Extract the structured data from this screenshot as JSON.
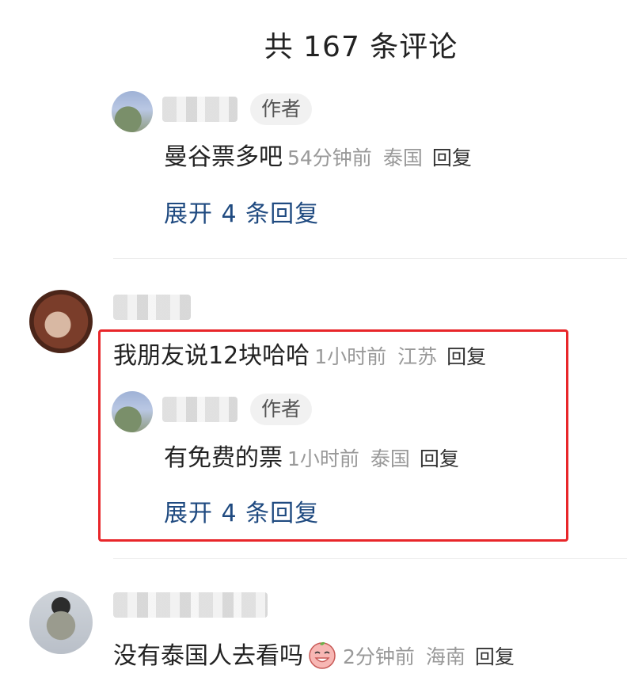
{
  "header": {
    "title": "共 167 条评论"
  },
  "comments": [
    {
      "is_reply": true,
      "author_badge": "作者",
      "text": "曼谷票多吧",
      "time": "54分钟前",
      "location": "泰国",
      "reply_label": "回复",
      "expand_label": "展开 4 条回复"
    },
    {
      "is_reply": false,
      "text": "我朋友说12块哈哈",
      "time": "1小时前",
      "location": "江苏",
      "reply_label": "回复",
      "child": {
        "author_badge": "作者",
        "text": "有免费的票",
        "time": "1小时前",
        "location": "泰国",
        "reply_label": "回复",
        "expand_label": "展开 4 条回复"
      }
    },
    {
      "is_reply": false,
      "text": "没有泰国人去看吗",
      "emoji": "grinning-peach-emoji",
      "time": "2分钟前",
      "location": "海南",
      "reply_label": "回复"
    }
  ],
  "colors": {
    "highlight_border": "#e8262a",
    "expand_link": "#1f4a80",
    "meta_text": "#999999"
  }
}
